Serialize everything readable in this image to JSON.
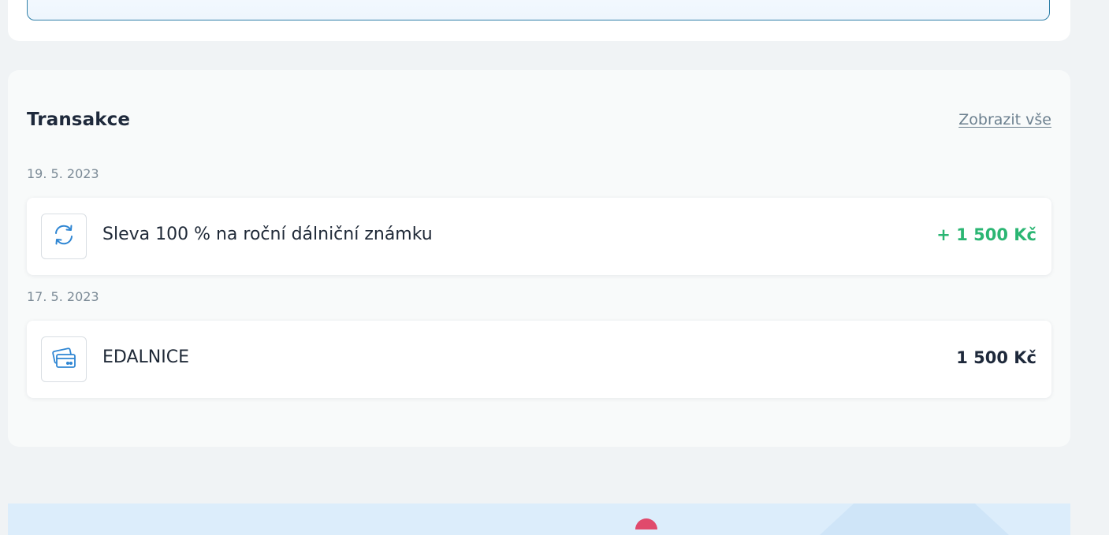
{
  "transactions": {
    "title": "Transakce",
    "show_all": "Zobrazit vše",
    "groups": [
      {
        "date": "19. 5. 2023",
        "items": [
          {
            "icon": "refresh-icon",
            "label": "Sleva 100 % na roční dálniční známku",
            "amount": "+ 1 500 Kč",
            "type": "credit"
          }
        ]
      },
      {
        "date": "17. 5. 2023",
        "items": [
          {
            "icon": "card-icon",
            "label": "EDALNICE",
            "amount": "1 500 Kč",
            "type": "debit"
          }
        ]
      }
    ]
  },
  "colors": {
    "credit": "#2bb673",
    "debit": "#1e293b",
    "icon_blue": "#2f86d3",
    "accent_border": "#2f7fa8"
  }
}
